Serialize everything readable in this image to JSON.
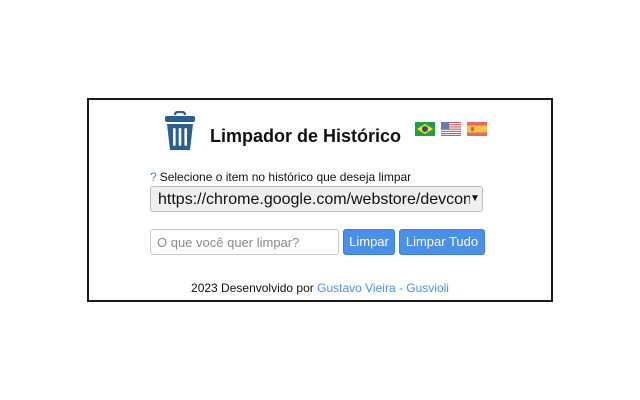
{
  "header": {
    "title": "Limpador de Histórico",
    "icon": "trash-can-icon"
  },
  "languages": [
    {
      "code": "pt-BR",
      "icon": "brazil-flag-icon"
    },
    {
      "code": "en-US",
      "icon": "usa-flag-icon"
    },
    {
      "code": "es",
      "icon": "spain-flag-icon"
    }
  ],
  "history_select": {
    "help_mark": "?",
    "label": "Selecione o item no histórico que deseja limpar",
    "selected_value": "https://chrome.google.com/webstore/devconsole"
  },
  "search": {
    "placeholder": "O que você quer limpar?"
  },
  "buttons": {
    "clear": "Limpar",
    "clear_all": "Limpar Tudo"
  },
  "footer": {
    "text": "2023 Desenvolvido por",
    "link_text": "Gustavo Vieira - Gusvioli"
  },
  "colors": {
    "accent": "#4a8fe8",
    "icon_blue": "#2a5f8f"
  }
}
